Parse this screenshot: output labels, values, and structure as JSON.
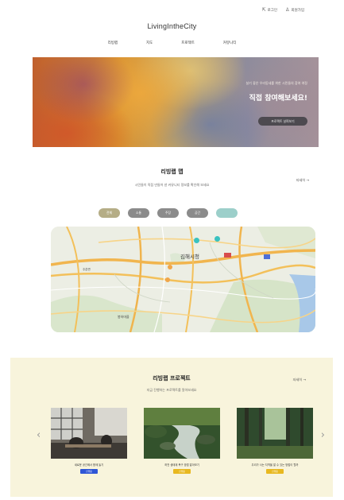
{
  "utility": {
    "login": "로그인",
    "signup": "회원가입"
  },
  "logo": "LivingIntheCity",
  "nav": [
    "리빙랩",
    "지도",
    "프로젝트",
    "커뮤니티"
  ],
  "hero": {
    "subtitle": "살기 좋은 우리동네를 위한 시민들의 참여 여정",
    "title": "직접 참여해보세요!",
    "button": "프로젝트 살펴보기"
  },
  "livinglab_map": {
    "title": "리빙랩 맵",
    "subtitle": "시민들이 직접 만들어 낸 커뮤니티 정보를 확인해 보세요",
    "more": "자세히 →",
    "filters": [
      {
        "label": "전체",
        "color": "#b5ad86"
      },
      {
        "label": "소통",
        "color": "#8b8b8b"
      },
      {
        "label": "주장",
        "color": "#8b8b8b"
      },
      {
        "label": "공간",
        "color": "#8b8b8b"
      },
      {
        "label": "",
        "color": "#9ccfca"
      }
    ],
    "map_labels": {
      "city": "김해시청",
      "park": "봉하마을",
      "left_town": "주촌면"
    }
  },
  "projects": {
    "title": "리빙랩 프로젝트",
    "subtitle": "지금 진행하는 프로젝트를 알아보세요",
    "more": "자세히 →",
    "prev": "‹",
    "next": "›",
    "cards": [
      {
        "caption": "새로운 공간에서 함께 놀기",
        "badge": "진행중",
        "badge_color": "#2f56d6"
      },
      {
        "caption": "하천 생태계 복구 방법 알아보기",
        "badge": "진행중",
        "badge_color": "#e8b820"
      },
      {
        "caption": "우리가 사는 지역을 알 수 있는 방법이 뭘까",
        "badge": "진행중",
        "badge_color": "#e8b820"
      }
    ]
  }
}
